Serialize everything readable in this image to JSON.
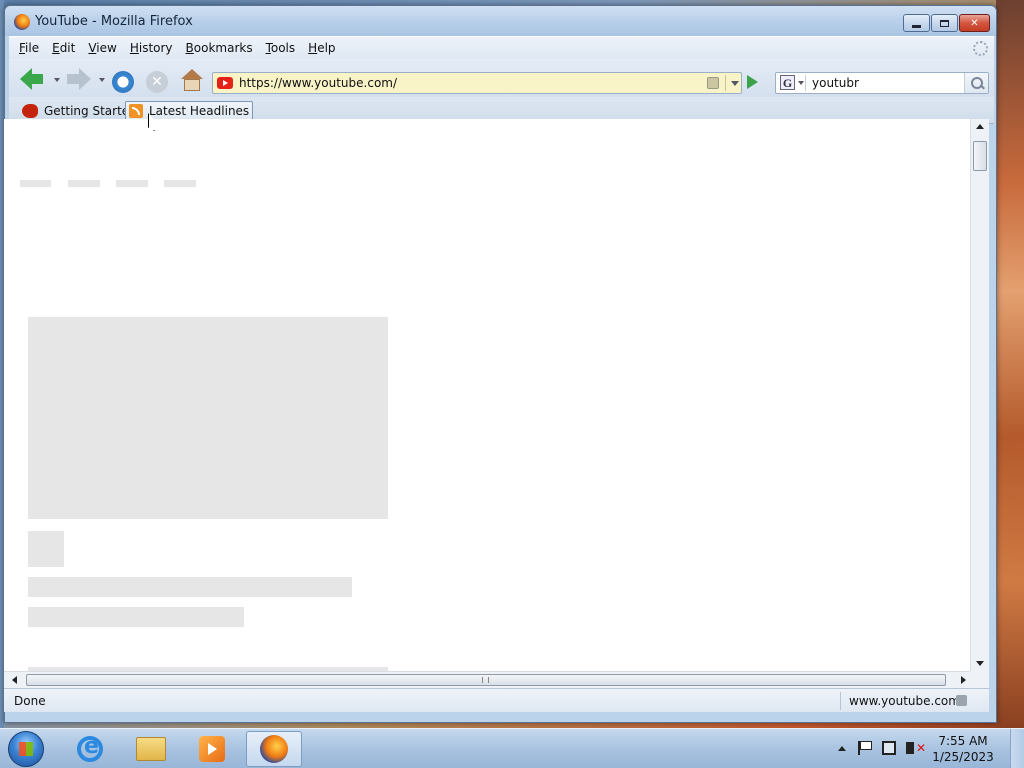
{
  "window": {
    "title": "YouTube - Mozilla Firefox",
    "controls": {
      "minimize": "minimize",
      "maximize": "maximize",
      "close": "close"
    }
  },
  "menubar": {
    "items": [
      {
        "key": "F",
        "rest": "ile"
      },
      {
        "key": "E",
        "rest": "dit"
      },
      {
        "key": "V",
        "rest": "iew"
      },
      {
        "key": "H",
        "rest": "istory"
      },
      {
        "key": "B",
        "rest": "ookmarks"
      },
      {
        "key": "T",
        "rest": "ools"
      },
      {
        "key": "H",
        "rest": "elp"
      }
    ]
  },
  "navbar": {
    "url": "https://www.youtube.com/",
    "search_value": "youtubr",
    "search_engine_letter": "G"
  },
  "bookmarks": {
    "items": [
      {
        "label": "Getting Started",
        "icon": "firefox-getting-started-icon"
      },
      {
        "label": "Latest Headlines",
        "icon": "rss-feed-icon"
      }
    ]
  },
  "statusbar": {
    "status": "Done",
    "domain": "www.youtube.com"
  },
  "taskbar": {
    "pinned": [
      "internet-explorer-icon",
      "windows-explorer-icon",
      "windows-media-player-icon",
      "firefox-icon"
    ],
    "clock_time": "7:55 AM",
    "clock_date": "1/25/2023"
  },
  "colors": {
    "youtube_red": "#e62117",
    "url_bar_bg": "#f8f4c8",
    "skeleton": "#e6e6e6"
  }
}
